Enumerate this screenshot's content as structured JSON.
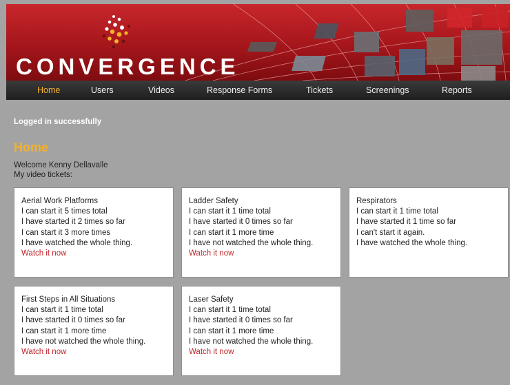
{
  "brand": {
    "name": "CONVERGENCE"
  },
  "nav": {
    "items": [
      {
        "label": "Home",
        "active": true
      },
      {
        "label": "Users"
      },
      {
        "label": "Videos"
      },
      {
        "label": "Response Forms"
      },
      {
        "label": "Tickets"
      },
      {
        "label": "Screenings"
      },
      {
        "label": "Reports"
      }
    ]
  },
  "flash": "Logged in successfully",
  "page": {
    "title": "Home",
    "welcome": "Welcome Kenny Dellavalle",
    "subtitle": "My video tickets:"
  },
  "tickets": [
    {
      "title": "Aerial Work Platforms",
      "lines": [
        "I can start it 5 times total",
        "I have started it 2 times so far",
        "I can start it 3 more times",
        "I have watched the whole thing."
      ],
      "link": "Watch it now"
    },
    {
      "title": "Ladder Safety",
      "lines": [
        "I can start it 1 time total",
        "I have started it 0 times so far",
        "I can start it 1 more time",
        "I have not watched the whole thing."
      ],
      "link": "Watch it now"
    },
    {
      "title": "Respirators",
      "lines": [
        "I can start it 1 time total",
        "I have started it 1 time so far",
        "I can't start it again.",
        "I have watched the whole thing."
      ],
      "link": null
    },
    {
      "title": "First Steps in All Situations",
      "lines": [
        "I can start it 1 time total",
        "I have started it 0 times so far",
        "I can start it 1 more time",
        "I have not watched the whole thing."
      ],
      "link": "Watch it now"
    },
    {
      "title": "Laser Safety",
      "lines": [
        "I can start it 1 time total",
        "I have started it 0 times so far",
        "I can start it 1 more time",
        "I have not watched the whole thing."
      ],
      "link": "Watch it now"
    }
  ],
  "colors": {
    "accent": "#f4b12b",
    "link": "#c0252b",
    "header_red": "#b01c21"
  }
}
